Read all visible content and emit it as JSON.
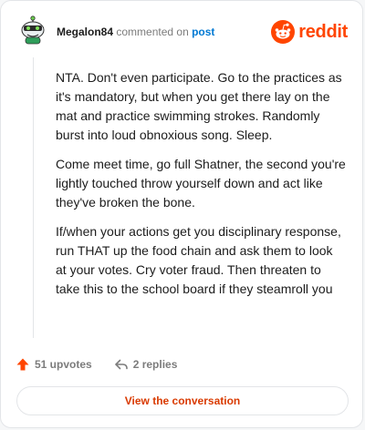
{
  "header": {
    "username": "Megalon84",
    "action_text": "commented on",
    "post_link": "post",
    "brand": "reddit"
  },
  "comment": {
    "paragraphs": [
      "NTA. Don't even participate. Go to the practices as it's mandatory, but when you get there lay on the mat and practice swimming strokes. Randomly burst into loud obnoxious song. Sleep.",
      "Come meet time, go full Shatner, the second you're lightly touched throw yourself down and act like they've broken the bone.",
      "If/when your actions get you disciplinary response, run THAT up the food chain and ask them to look at your votes. Cry voter fraud. Then threaten to take this to the school board if they steamroll you"
    ]
  },
  "footer": {
    "upvotes": "51 upvotes",
    "replies": "2 replies",
    "view_button": "View the conversation"
  },
  "colors": {
    "brand": "#ff4500",
    "link": "#0079d3",
    "button_text": "#d93a00",
    "muted": "#7c7c7c"
  },
  "icons": {
    "avatar": "snoo-avatar-icon",
    "logo": "reddit-snoo-icon",
    "upvote": "upvote-arrow-icon",
    "reply": "reply-arrow-icon"
  }
}
